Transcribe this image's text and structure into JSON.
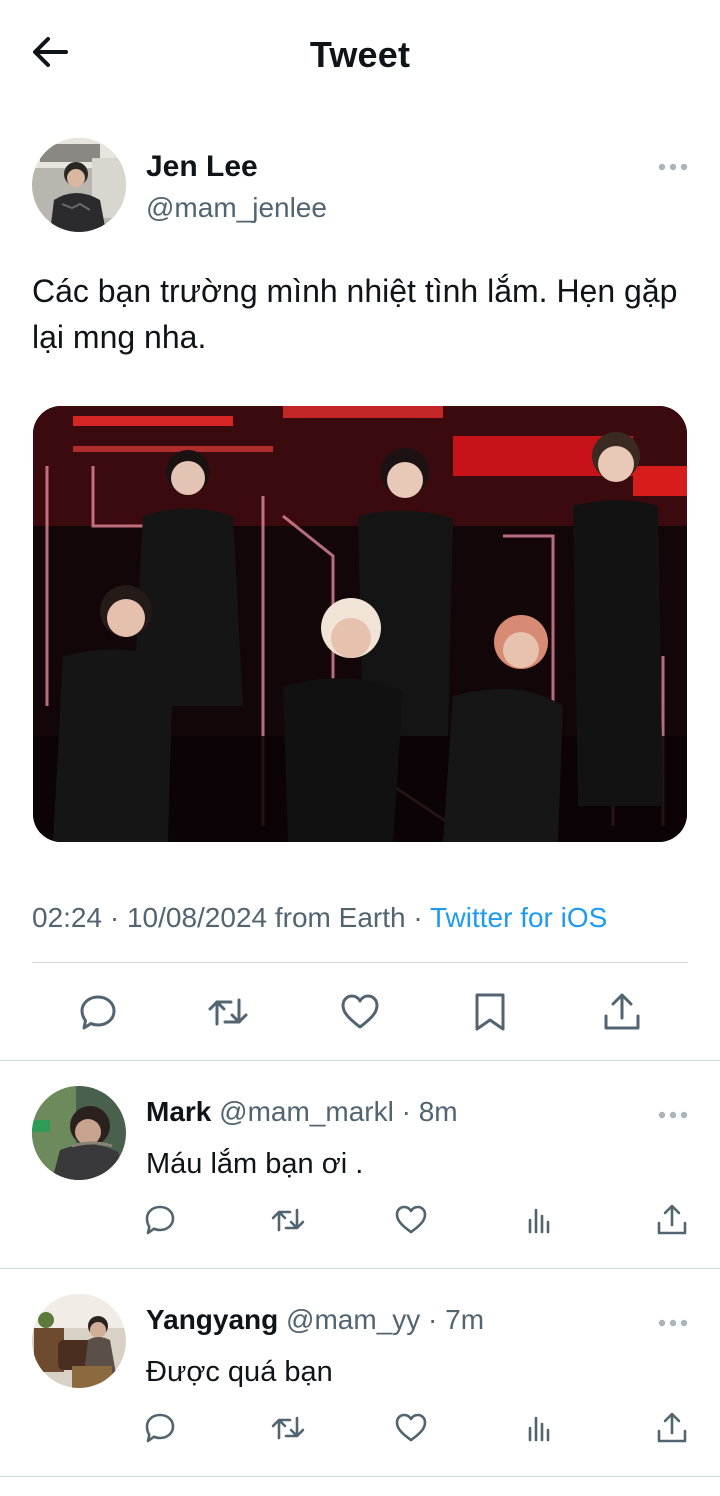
{
  "header": {
    "title": "Tweet"
  },
  "tweet": {
    "author_name": "Jen Lee",
    "author_handle": "@mam_jenlee",
    "text": "Các bạn trường mình nhiệt tình lắm. Hẹn gặp lại mng nha.",
    "timestamp": "02:24 · 10/08/2024 from Earth · ",
    "source": "Twitter for iOS",
    "actions": [
      "reply-icon",
      "retweet-icon",
      "like-icon",
      "bookmark-icon",
      "share-icon"
    ]
  },
  "replies": [
    {
      "name": "Mark",
      "handle": "@mam_markl",
      "dot": "·",
      "time": "8m",
      "text": "Máu lắm bạn ơi ."
    },
    {
      "name": "Yangyang",
      "handle": "@mam_yy",
      "dot": "·",
      "time": "7m",
      "text": "Được quá bạn"
    }
  ],
  "colors": {
    "accent": "#1d9bf0",
    "secondary_text": "#536471",
    "divider": "#cfd9de",
    "stage_red": "#e0141c"
  }
}
